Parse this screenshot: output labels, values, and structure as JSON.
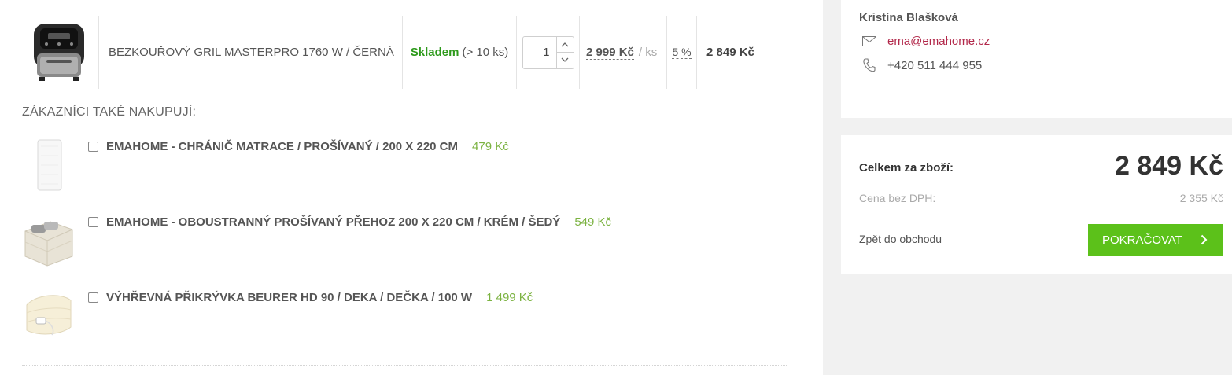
{
  "cart_item": {
    "name": "BEZKOUŘOVÝ GRIL MASTERPRO 1760 W / ČERNÁ",
    "stock_status": "Skladem",
    "stock_qty": "(> 10 ks)",
    "quantity": "1",
    "unit_price": "2 999 Kč",
    "unit_label": "/ ks",
    "discount": "5 %",
    "total": "2 849 Kč",
    "image_icon": "air-fryer-grill-image"
  },
  "upsell": {
    "title": "ZÁKAZNÍCI TAKÉ NAKUPUJÍ:",
    "items": [
      {
        "name": "EMAHOME - CHRÁNIČ MATRACE / PROŠÍVANÝ / 200 X 220 CM",
        "price": "479 Kč",
        "icon": "mattress-protector-image"
      },
      {
        "name": "EMAHOME - OBOUSTRANNÝ PROŠÍVANÝ PŘEHOZ 200 X 220 CM / KRÉM / ŠEDÝ",
        "price": "549 Kč",
        "icon": "bedspread-image"
      },
      {
        "name": "VÝHŘEVNÁ PŘIKRÝVKA BEURER HD 90 / DEKA / DEČKA / 100 W",
        "price": "1 499 Kč",
        "icon": "heated-blanket-image"
      }
    ]
  },
  "contact": {
    "name": "Kristína Blašková",
    "email": "ema@emahome.cz",
    "phone": "+420 511 444 955"
  },
  "summary": {
    "total_label": "Celkem za zboží:",
    "total_value": "2 849 Kč",
    "net_label": "Cena bez DPH:",
    "net_value": "2 355 Kč",
    "back_label": "Zpět do obchodu",
    "continue_label": "POKRAČOVAT"
  },
  "colors": {
    "accent_green": "#5cc11a",
    "stock_green": "#2e9a1c",
    "price_green": "#7cb342",
    "link_red": "#b2284a",
    "sidebar_bg": "#f1f1f1"
  }
}
